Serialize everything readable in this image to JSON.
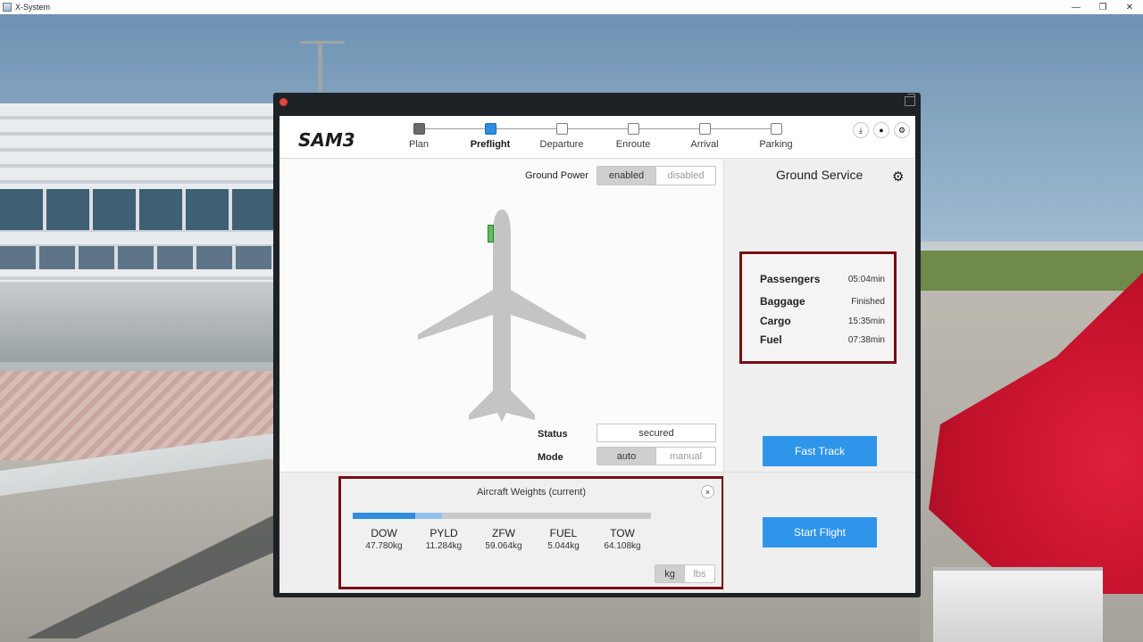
{
  "os": {
    "title": "X-System",
    "minimize": "—",
    "restore": "❐",
    "close": "✕"
  },
  "app": {
    "brand": "SAM3",
    "header_icons": [
      "download-icon",
      "record-icon",
      "settings-icon"
    ],
    "steps": [
      {
        "label": "Plan",
        "state": "done"
      },
      {
        "label": "Preflight",
        "state": "current"
      },
      {
        "label": "Departure",
        "state": "pending"
      },
      {
        "label": "Enroute",
        "state": "pending"
      },
      {
        "label": "Arrival",
        "state": "pending"
      },
      {
        "label": "Parking",
        "state": "pending"
      }
    ],
    "accent_color": "#2f95ea"
  },
  "ground_power": {
    "label": "Ground Power",
    "options": [
      "enabled",
      "disabled"
    ],
    "selected": "enabled"
  },
  "status": {
    "label": "Status",
    "value": "secured"
  },
  "mode": {
    "label": "Mode",
    "options": [
      "auto",
      "manual"
    ],
    "selected": "auto"
  },
  "ground_service": {
    "title": "Ground Service",
    "items": [
      {
        "name": "Passengers",
        "value": "05:04min"
      },
      {
        "name": "Baggage",
        "value": "Finished"
      },
      {
        "name": "Cargo",
        "value": "15:35min"
      },
      {
        "name": "Fuel",
        "value": "07:38min"
      }
    ],
    "fast_track_label": "Fast Track",
    "start_flight_label": "Start Flight"
  },
  "weights": {
    "title": "Aircraft Weights (current)",
    "close_glyph": "×",
    "bar_dow_fraction": 0.21,
    "bar_pyld_fraction": 0.09,
    "items": [
      {
        "key": "DOW",
        "value": "47.780kg"
      },
      {
        "key": "PYLD",
        "value": "11.284kg"
      },
      {
        "key": "ZFW",
        "value": "59.064kg"
      },
      {
        "key": "FUEL",
        "value": "5.044kg"
      },
      {
        "key": "TOW",
        "value": "64.108kg"
      }
    ],
    "units": [
      "kg",
      "lbs"
    ],
    "selected_unit": "kg"
  }
}
